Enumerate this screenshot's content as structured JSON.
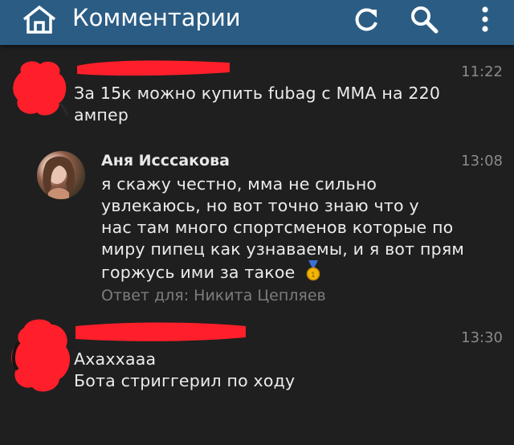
{
  "appbar": {
    "title": "Комментарии",
    "icons": [
      "home-icon",
      "refresh-icon",
      "search-icon",
      "more-vert-icon"
    ],
    "color": "#2b5c84"
  },
  "comments": [
    {
      "author": "",
      "time": "11:22",
      "lines": [
        "За 15к можно купить fubag с MMA на 220",
        "ампер"
      ]
    },
    {
      "author": "Аня Исссакова",
      "time": "13:08",
      "lines": [
        "я скажу честно, мма не сильно",
        "увлекаюсь, но вот точно знаю что у",
        "нас там много спортсменов которые по",
        "миру пипец как узнаваемы, и я вот прям",
        "горжусь ими за такое"
      ],
      "emoji": "🥇",
      "reply_to": "Ответ для: Никита Цепляев"
    },
    {
      "author": "",
      "time": "13:30",
      "lines": [
        "Ахаххааа",
        "Бота стриггерил по ходу"
      ]
    }
  ],
  "colors": {
    "background": "#1f1f1f",
    "redaction": "#ff1f2a",
    "text": "#ececec",
    "muted": "#8a8a8a"
  }
}
